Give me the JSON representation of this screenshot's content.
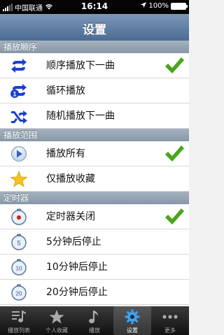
{
  "status": {
    "carrier": "中国联通",
    "time": "16:14",
    "battery": "100%"
  },
  "nav": {
    "title": "设置"
  },
  "sections": {
    "play_order": "播放顺序",
    "play_range": "播放范围",
    "timer": "定时器"
  },
  "play_order": [
    {
      "label": "顺序播放下一曲",
      "selected": true
    },
    {
      "label": "循环播放",
      "selected": false
    },
    {
      "label": "随机播放下一曲",
      "selected": false
    }
  ],
  "play_range": [
    {
      "label": "播放所有",
      "selected": true
    },
    {
      "label": "仅播放收藏",
      "selected": false
    }
  ],
  "timer": [
    {
      "label": "定时器关闭",
      "selected": true
    },
    {
      "label": "5分钟后停止",
      "badge": "5"
    },
    {
      "label": "10分钟后停止",
      "badge": "10"
    },
    {
      "label": "20分钟后停止",
      "badge": "20"
    }
  ],
  "tabs": [
    {
      "label": "播放列表",
      "icon": "playlist-icon"
    },
    {
      "label": "个人收藏",
      "icon": "star-icon"
    },
    {
      "label": "播放",
      "icon": "music-note-icon"
    },
    {
      "label": "设置",
      "icon": "gear-icon",
      "active": true
    },
    {
      "label": "更多",
      "icon": "more-icon"
    }
  ],
  "colors": {
    "accent_blue": "#1a3fd0",
    "check_green": "#4aa51c",
    "nav_blue": "#5d7ca3"
  }
}
